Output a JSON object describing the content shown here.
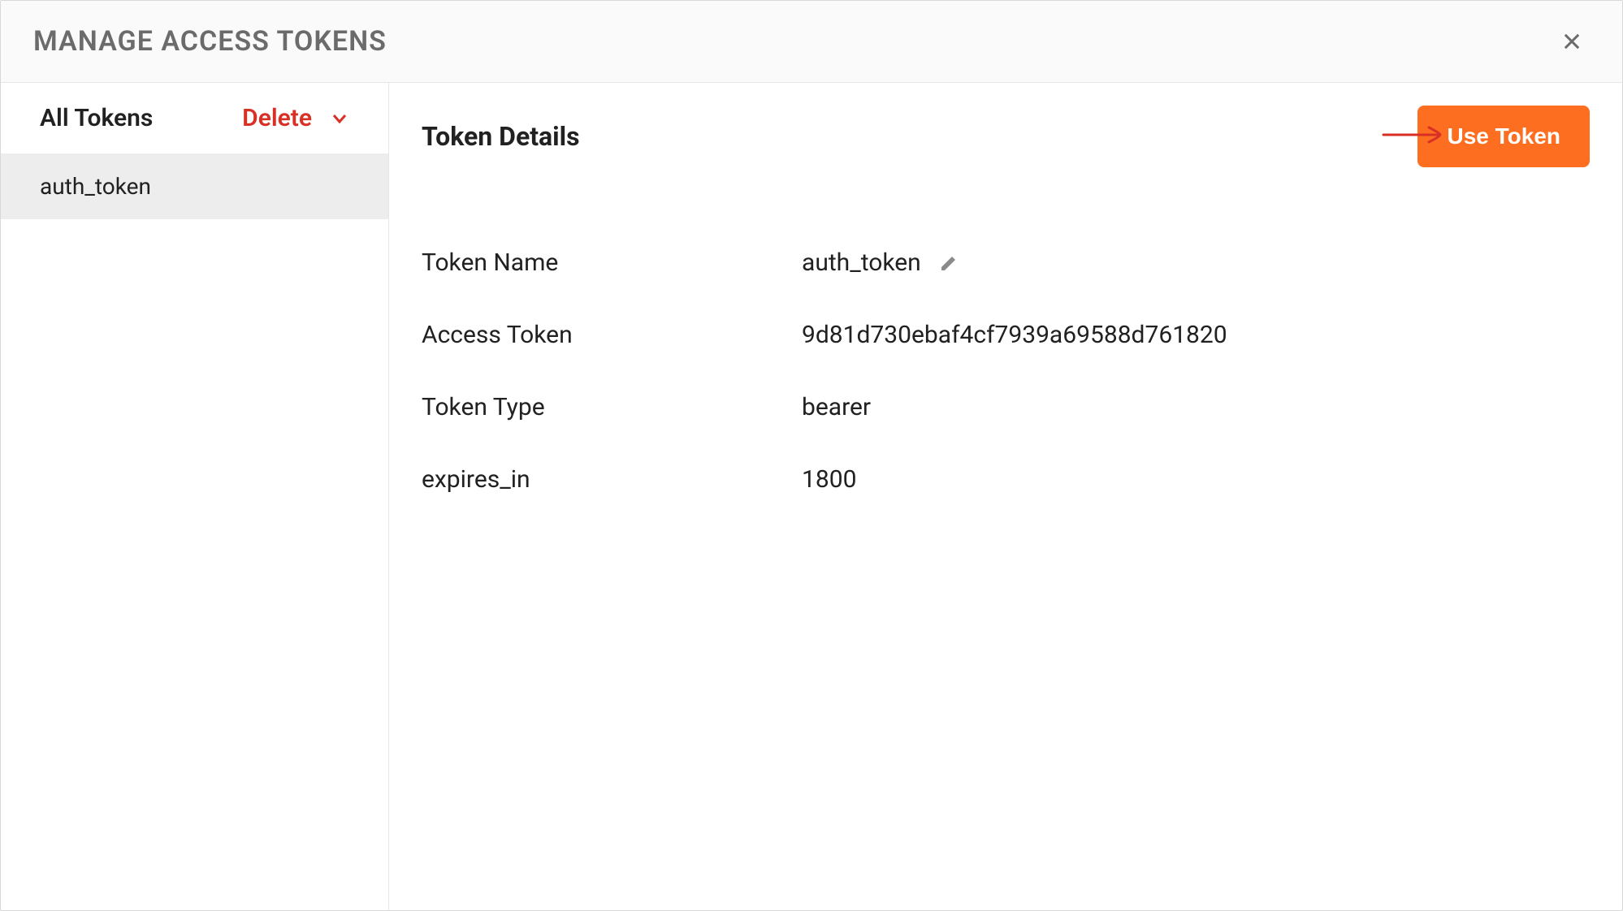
{
  "modal": {
    "title": "MANAGE ACCESS TOKENS"
  },
  "sidebar": {
    "header_label": "All Tokens",
    "delete_label": "Delete",
    "tokens": [
      {
        "name": "auth_token"
      }
    ]
  },
  "details": {
    "title": "Token Details",
    "use_token_label": "Use Token",
    "rows": [
      {
        "label": "Token Name",
        "value": "auth_token",
        "editable": true
      },
      {
        "label": "Access Token",
        "value": "9d81d730ebaf4cf7939a69588d761820",
        "editable": false
      },
      {
        "label": "Token Type",
        "value": "bearer",
        "editable": false
      },
      {
        "label": "expires_in",
        "value": "1800",
        "editable": false
      }
    ]
  }
}
